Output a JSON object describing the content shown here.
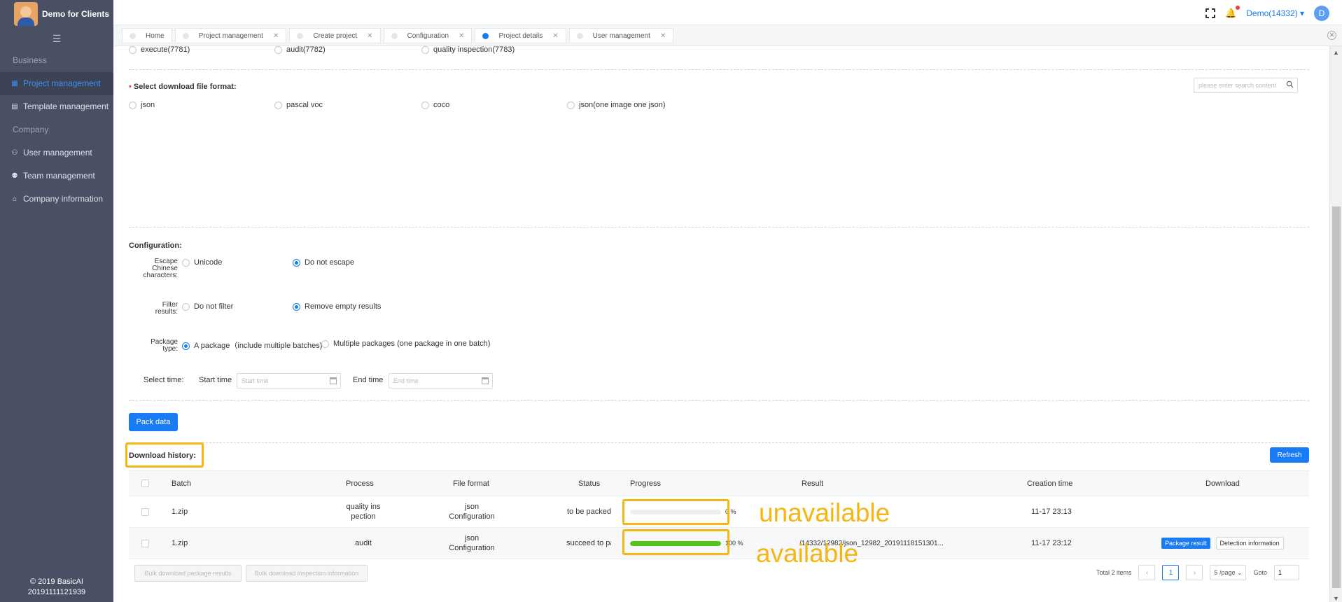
{
  "app": {
    "title": "Demo for Clients",
    "copyright": "© 2019 BasicAI",
    "build": "20191111121939"
  },
  "sidebar": {
    "groups": [
      {
        "label": "Business"
      },
      {
        "label": "Company"
      }
    ],
    "items": [
      {
        "label": "Project management",
        "icon": "grid-icon"
      },
      {
        "label": "Template management",
        "icon": "table-icon"
      },
      {
        "label": "User management",
        "icon": "users-icon"
      },
      {
        "label": "Team management",
        "icon": "team-icon"
      },
      {
        "label": "Company information",
        "icon": "home-icon"
      }
    ]
  },
  "header": {
    "user": "Demo(14332)",
    "avatar_letter": "D"
  },
  "tabs": [
    {
      "label": "Home"
    },
    {
      "label": "Project management"
    },
    {
      "label": "Create project"
    },
    {
      "label": "Configuration"
    },
    {
      "label": "Project details"
    },
    {
      "label": "User management"
    }
  ],
  "process_options": [
    "execute(7781)",
    "audit(7782)",
    "quality inspection(7783)"
  ],
  "format": {
    "label": "Select download file format:",
    "search_placeholder": "please enter search content",
    "options": [
      "json",
      "pascal voc",
      "coco",
      "json(one image one json)"
    ]
  },
  "config": {
    "title": "Configuration:",
    "escape_label": "Escape Chinese characters:",
    "escape_options": [
      "Unicode",
      "Do not escape"
    ],
    "filter_label": "Filter results:",
    "filter_options": [
      "Do not filter",
      "Remove empty results"
    ],
    "package_label": "Package type:",
    "package_options": [
      "A package（include multiple batches)",
      "Multiple packages (one package in one batch)"
    ],
    "select_time_label": "Select time:",
    "start_label": "Start time",
    "start_placeholder": "Start time",
    "end_label": "End time",
    "end_placeholder": "End time"
  },
  "pack_button": "Pack data",
  "history": {
    "title": "Download history:",
    "refresh": "Refresh",
    "columns": [
      "Batch",
      "Process",
      "File format",
      "Status",
      "Progress",
      "Result",
      "Creation time",
      "Download"
    ],
    "rows": [
      {
        "batch": "1.zip",
        "process": "quality ins\npection",
        "format": "json\nConfiguration",
        "status": "to be packed",
        "progress": 0,
        "progress_text": "0 %",
        "result": "",
        "created": "11-17 23:13"
      },
      {
        "batch": "1.zip",
        "process": "audit",
        "format": "json\nConfiguration",
        "status": "succeed to pa",
        "progress": 100,
        "progress_text": "100 %",
        "result": "/14332/12982/json_12982_20191118151301...",
        "created": "11-17 23:12",
        "dl_primary": "Package result",
        "dl_secondary": "Detection information"
      }
    ],
    "bulk_package": "Bulk download package results",
    "bulk_inspection": "Bulk download inspection information"
  },
  "pagination": {
    "total": "Total 2 items",
    "current": "1",
    "size": "5 /page",
    "goto_label": "Goto",
    "goto_value": "1"
  },
  "annotations": {
    "unavailable": "unavailable",
    "available": "available",
    "highlight_color": "#f5b614"
  }
}
